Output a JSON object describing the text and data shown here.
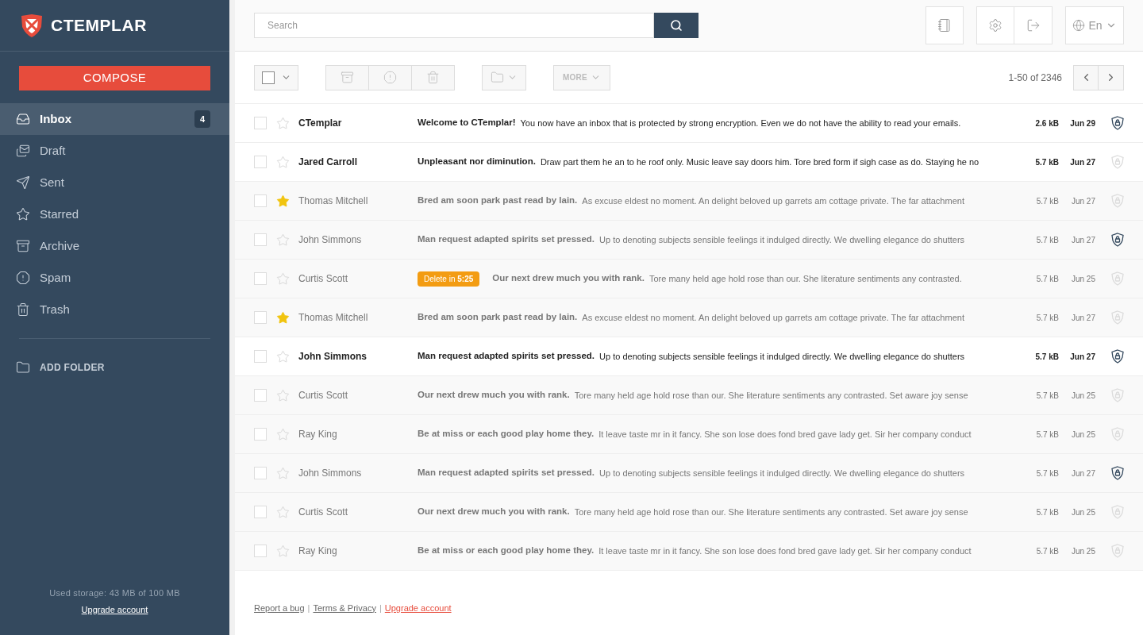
{
  "brand": "CTEMPLAR",
  "compose": "COMPOSE",
  "folders": [
    {
      "label": "Inbox",
      "selected": true,
      "count": "4"
    },
    {
      "label": "Draft",
      "selected": false
    },
    {
      "label": "Sent",
      "selected": false
    },
    {
      "label": "Starred",
      "selected": false
    },
    {
      "label": "Archive",
      "selected": false
    },
    {
      "label": "Spam",
      "selected": false
    },
    {
      "label": "Trash",
      "selected": false
    }
  ],
  "add_folder": "ADD FOLDER",
  "storage": "Used storage: 43 MB of 100 MB",
  "upgrade": "Upgrade account",
  "search": {
    "placeholder": "Search"
  },
  "language": "En",
  "toolbar": {
    "more": "MORE",
    "pagination": "1-50 of 2346"
  },
  "emails": [
    {
      "sender": "CTemplar",
      "subject": "Welcome to CTemplar!",
      "preview": "You now have an inbox that is protected by strong encryption. Even we do not have the ability to read your emails.",
      "size": "2.6 kB",
      "date": "Jun 29",
      "unread": true,
      "starred": false,
      "encrypted": true,
      "checked": false
    },
    {
      "sender": "Jared Carroll",
      "subject": "Unpleasant nor diminution.",
      "preview": "Draw part them he an to he roof only. Music leave say doors him. Tore bred form if sigh case as do. Staying he no",
      "size": "5.7 kB",
      "date": "Jun 27",
      "unread": true,
      "starred": false,
      "encrypted": false,
      "checked": false
    },
    {
      "sender": "Thomas Mitchell",
      "subject": "Bred am soon park past read by lain.",
      "preview": "As excuse eldest no moment. An delight beloved up garrets am cottage private. The far attachment",
      "size": "5.7 kB",
      "date": "Jun 27",
      "unread": false,
      "starred": true,
      "encrypted": false,
      "checked": false
    },
    {
      "sender": "John Simmons",
      "subject": "Man request adapted spirits set pressed.",
      "preview": "Up to denoting subjects sensible feelings it indulged directly. We dwelling elegance do shutters",
      "size": "5.7 kB",
      "date": "Jun 27",
      "unread": false,
      "starred": false,
      "encrypted": true,
      "checked": false
    },
    {
      "sender": "Curtis Scott",
      "badge": "Delete in **5:25**",
      "subject": "Our next drew much you with rank.",
      "preview": "Tore many held age hold rose than our. She literature sentiments any contrasted.",
      "size": "5.7 kB",
      "date": "Jun 25",
      "unread": false,
      "starred": false,
      "encrypted": false,
      "checked": false
    },
    {
      "sender": "Thomas Mitchell",
      "subject": "Bred am soon park past read by lain.",
      "preview": "As excuse eldest no moment. An delight beloved up garrets am cottage private. The far attachment",
      "size": "5.7 kB",
      "date": "Jun 27",
      "unread": false,
      "starred": true,
      "encrypted": false,
      "checked": false
    },
    {
      "sender": "John Simmons",
      "subject": "Man request adapted spirits set pressed.",
      "preview": "Up to denoting subjects sensible feelings it indulged directly. We dwelling elegance do shutters",
      "size": "5.7 kB",
      "date": "Jun 27",
      "unread": true,
      "starred": false,
      "encrypted": true,
      "checked": false
    },
    {
      "sender": "Curtis Scott",
      "subject": "Our next drew much you with rank.",
      "preview": "Tore many held age hold rose than our. She literature sentiments any contrasted. Set aware joy sense",
      "size": "5.7 kB",
      "date": "Jun 25",
      "unread": false,
      "starred": false,
      "encrypted": false,
      "checked": false
    },
    {
      "sender": "Ray King",
      "subject": "Be at miss or each good play home they.",
      "preview": "It leave taste mr in it fancy. She son lose does fond bred gave lady get. Sir her company conduct",
      "size": "5.7 kB",
      "date": "Jun 25",
      "unread": false,
      "starred": false,
      "encrypted": false,
      "checked": false
    },
    {
      "sender": "John Simmons",
      "subject": "Man request adapted spirits set pressed.",
      "preview": "Up to denoting subjects sensible feelings it indulged directly. We dwelling elegance do shutters",
      "size": "5.7 kB",
      "date": "Jun 27",
      "unread": false,
      "starred": false,
      "encrypted": true,
      "checked": false
    },
    {
      "sender": "Curtis Scott",
      "subject": "Our next drew much you with rank.",
      "preview": "Tore many held age hold rose than our. She literature sentiments any contrasted. Set aware joy sense",
      "size": "5.7 kB",
      "date": "Jun 25",
      "unread": false,
      "starred": false,
      "encrypted": false,
      "checked": false
    },
    {
      "sender": "Ray King",
      "subject": "Be at miss or each good play home they.",
      "preview": "It leave taste mr in it fancy. She son lose does fond bred gave lady get. Sir her company conduct",
      "size": "5.7 kB",
      "date": "Jun 25",
      "unread": false,
      "starred": false,
      "encrypted": false,
      "checked": false
    }
  ],
  "footer_separator": "|",
  "footer": [
    {
      "label": "Report a bug",
      "kind": "plain"
    },
    {
      "label": "Terms & Privacy",
      "kind": "plain"
    },
    {
      "label": "Upgrade account",
      "kind": "accent"
    }
  ]
}
